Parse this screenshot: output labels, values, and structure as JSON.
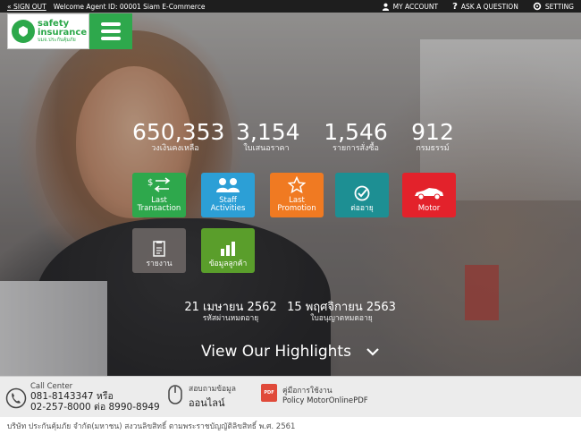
{
  "topbar": {
    "signout": "« SIGN OUT",
    "welcome": "Welcome Agent ID: 00001 Siam E-Commerce",
    "account": "MY ACCOUNT",
    "question": "ASK A QUESTION",
    "setting": "SETTING"
  },
  "logo": {
    "line1": "safety",
    "line2": "insurance",
    "line3": "บมจ.ประกันคุ้มภัย"
  },
  "stats": [
    {
      "num": "650,353",
      "label": "วงเงินคงเหลือ"
    },
    {
      "num": "3,154",
      "label": "ใบเสนอราคา"
    },
    {
      "num": "1,546",
      "label": "รายการสั่งซื้อ"
    },
    {
      "num": "912",
      "label": "กรมธรรม์"
    }
  ],
  "tiles": [
    {
      "label": "Last\nTransaction",
      "color": "#2ea84c",
      "icon": "transfer-icon"
    },
    {
      "label": "Staff\nActivities",
      "color": "#2c9fd6",
      "icon": "staff-icon"
    },
    {
      "label": "Last\nPromotion",
      "color": "#f07a22",
      "icon": "star-icon"
    },
    {
      "label": "ต่ออายุ",
      "color": "#1d8f93",
      "icon": "renew-icon"
    },
    {
      "label": "Motor",
      "color": "#e3222b",
      "icon": "car-icon"
    },
    {
      "label": "รายงาน",
      "color": "#6a6463",
      "icon": "report-icon"
    },
    {
      "label": "ข้อมูลลูกค้า",
      "color": "#5a9e2b",
      "icon": "chart-icon"
    }
  ],
  "dates": [
    {
      "date": "21 เมษายน 2562",
      "label": "รหัสผ่านหมดอายุ"
    },
    {
      "date": "15 พฤศจิกายน 2563",
      "label": "ใบอนุญาตหมดอายุ"
    }
  ],
  "highlights": "View Our Highlights",
  "footer": {
    "call_label": "Call Center",
    "call_line1": "081-8143347 หรือ",
    "call_line2": "02-257-8000 ต่อ 8990-8949",
    "online_line1": "สอบถามข้อมูล",
    "online_line2": "ออนไลน์",
    "pdf_badge": "PDF",
    "manual_line1": "คู่มือการใช้งาน",
    "manual_line2": "Policy MotorOnlinePDF"
  },
  "copyright": "บริษัท ประกันคุ้มภัย จำกัด(มหาชน) สงวนลิขสิทธิ์ ตามพระราชบัญญัติลิขสิทธิ์ พ.ศ. 2561"
}
